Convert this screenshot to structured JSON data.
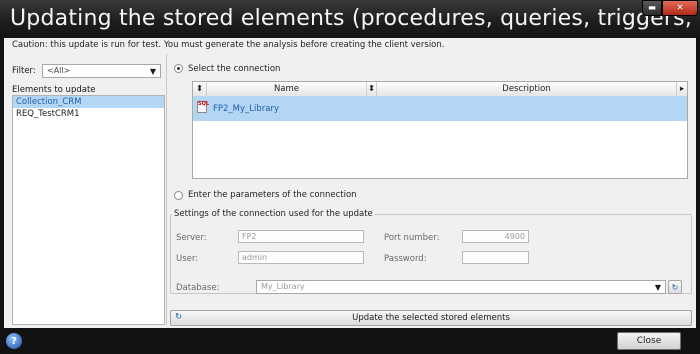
{
  "window": {
    "title": "Updating the stored elements (procedures, queries, triggers, ...)",
    "minimize_glyph": "▬",
    "close_glyph": "✕"
  },
  "caution": "Caution: this update is run for test. You must generate the analysis before creating the client version.",
  "filter": {
    "label": "Filter:",
    "value": "<All>"
  },
  "elements": {
    "label": "Elements to update",
    "items": [
      "Collection_CRM",
      "REQ_TestCRM1"
    ],
    "selected_index": 0
  },
  "connection": {
    "select_label": "Select the connection",
    "selected": true,
    "columns": [
      "Name",
      "Description"
    ],
    "rows": [
      {
        "name": "FP2_My_Library",
        "description": ""
      }
    ],
    "enter_label": "Enter the parameters of the connection"
  },
  "settings": {
    "group_label": "Settings of the connection used for the update",
    "server_label": "Server:",
    "server_value": "FP2",
    "port_label": "Port number:",
    "port_value": "4900",
    "user_label": "User:",
    "user_value": "admin",
    "password_label": "Password:",
    "password_value": "",
    "database_label": "Database:",
    "database_value": "My_Library"
  },
  "update_button": "Update the selected stored elements",
  "footer": {
    "help_glyph": "?",
    "close_label": "Close"
  },
  "icons": {
    "sort": "sort-arrows-icon",
    "refresh": "refresh-icon",
    "database": "database-icon",
    "help": "help-icon"
  }
}
